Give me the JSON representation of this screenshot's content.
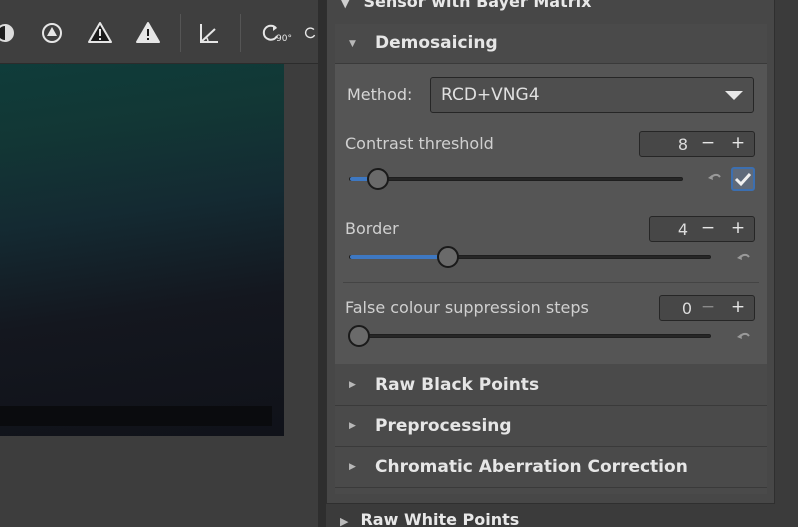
{
  "toolbar": {
    "icons": [
      "half-circle-icon",
      "warning-circle-icon",
      "warning-outline-icon",
      "warning-filled-icon",
      "angle-icon",
      "rotate-90-icon"
    ],
    "rotate_label": "90°"
  },
  "panel": {
    "outer_title": "Sensor with Bayer Matrix",
    "bottom_title": "Raw White Points",
    "demosaicing": {
      "title": "Demosaicing",
      "method_label": "Method:",
      "method_value": "RCD+VNG4",
      "contrast_label": "Contrast threshold",
      "contrast_value": "8",
      "contrast_fraction": 0.06,
      "contrast_auto_checked": true,
      "border_label": "Border",
      "border_value": "4",
      "border_fraction": 0.26,
      "fcs_label": "False colour suppression steps",
      "fcs_value": "0",
      "fcs_fraction": 0.0
    },
    "sections": [
      "Raw Black Points",
      "Preprocessing",
      "Chromatic Aberration Correction"
    ]
  },
  "colors": {
    "accent": "#3e78c2",
    "panel_bg": "#474747"
  }
}
